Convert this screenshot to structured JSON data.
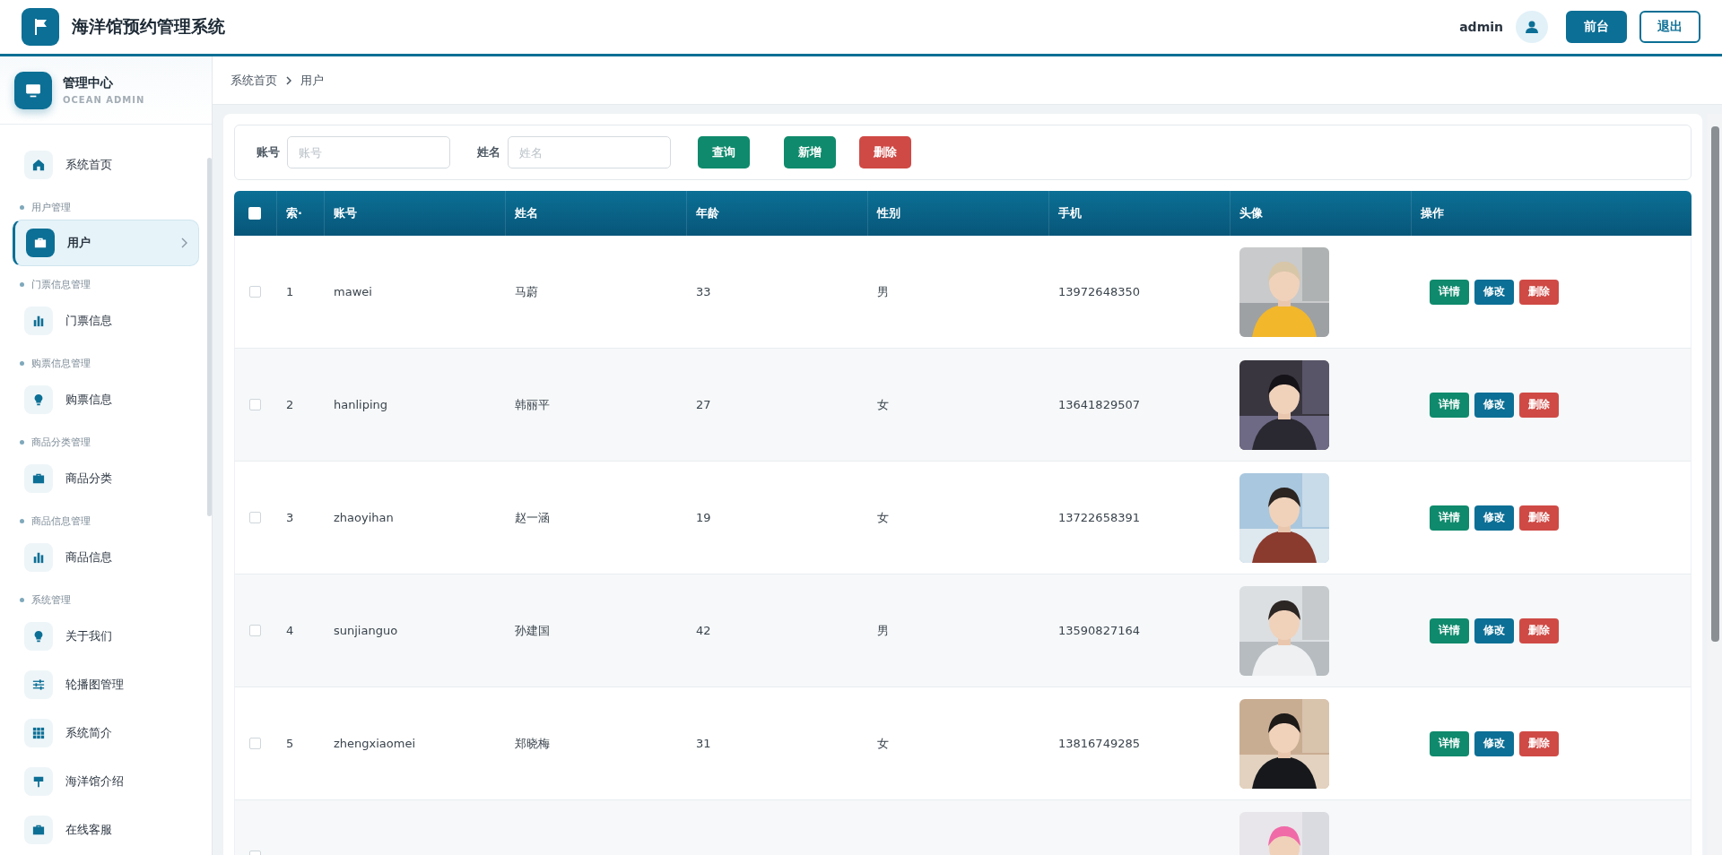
{
  "header": {
    "title": "海洋馆预约管理系统",
    "user": "admin",
    "buttons": [
      {
        "label": "前台",
        "kind": "solid"
      },
      {
        "label": "退出",
        "kind": "outline"
      }
    ]
  },
  "sidebar": {
    "title": "管理中心",
    "subtitle": "OCEAN ADMIN",
    "groups": [
      {
        "items": [
          {
            "label": "系统首页",
            "selected": false
          }
        ]
      },
      {
        "label": "用户管理",
        "items": [
          {
            "label": "用户",
            "selected": true
          }
        ]
      },
      {
        "label": "门票信息管理",
        "items": [
          {
            "label": "门票信息",
            "selected": false
          }
        ]
      },
      {
        "label": "购票信息管理",
        "items": [
          {
            "label": "购票信息",
            "selected": false
          }
        ]
      },
      {
        "label": "商品分类管理",
        "items": [
          {
            "label": "商品分类",
            "selected": false
          }
        ]
      },
      {
        "label": "商品信息管理",
        "items": [
          {
            "label": "商品信息",
            "selected": false
          }
        ]
      },
      {
        "label": "系统管理",
        "items": [
          {
            "label": "关于我们",
            "selected": false
          },
          {
            "label": "轮播图管理",
            "selected": false
          },
          {
            "label": "系统简介",
            "selected": false
          },
          {
            "label": "海洋馆介绍",
            "selected": false
          },
          {
            "label": "在线客服",
            "selected": false
          }
        ]
      }
    ]
  },
  "breadcrumb": [
    "系统首页",
    "用户"
  ],
  "search": {
    "fields": [
      {
        "label": "账号",
        "placeholder": "账号"
      },
      {
        "label": "姓名",
        "placeholder": "姓名"
      }
    ],
    "buttons": [
      {
        "label": "查询",
        "kind": "green"
      },
      {
        "label": "新增",
        "kind": "green"
      },
      {
        "label": "删除",
        "kind": "red"
      }
    ]
  },
  "table": {
    "header_checked": false,
    "columns": [
      "索·",
      "账号",
      "姓名",
      "年龄",
      "性别",
      "手机",
      "头像",
      "操作"
    ],
    "rows": [
      {
        "checked": false,
        "cells": [
          "1",
          "mawei",
          "马蔚",
          "33",
          "男",
          "13972648350"
        ],
        "avatar": {
          "kind": "picture"
        },
        "actions": [
          {
            "label": "详情",
            "kind": "green"
          },
          {
            "label": "修改",
            "kind": "blue"
          },
          {
            "label": "删除",
            "kind": "red"
          }
        ]
      },
      {
        "checked": false,
        "cells": [
          "2",
          "hanliping",
          "韩丽平",
          "27",
          "女",
          "13641829507"
        ],
        "avatar": {
          "kind": "picture"
        },
        "actions": [
          {
            "label": "详情",
            "kind": "green"
          },
          {
            "label": "修改",
            "kind": "blue"
          },
          {
            "label": "删除",
            "kind": "red"
          }
        ]
      },
      {
        "checked": false,
        "cells": [
          "3",
          "zhaoyihan",
          "赵一涵",
          "19",
          "女",
          "13722658391"
        ],
        "avatar": {
          "kind": "picture"
        },
        "actions": [
          {
            "label": "详情",
            "kind": "green"
          },
          {
            "label": "修改",
            "kind": "blue"
          },
          {
            "label": "删除",
            "kind": "red"
          }
        ]
      },
      {
        "checked": false,
        "cells": [
          "4",
          "sunjianguo",
          "孙建国",
          "42",
          "男",
          "13590827164"
        ],
        "avatar": {
          "kind": "picture"
        },
        "actions": [
          {
            "label": "详情",
            "kind": "green"
          },
          {
            "label": "修改",
            "kind": "blue"
          },
          {
            "label": "删除",
            "kind": "red"
          }
        ]
      },
      {
        "checked": false,
        "cells": [
          "5",
          "zhengxiaomei",
          "郑晓梅",
          "31",
          "女",
          "13816749285"
        ],
        "avatar": {
          "kind": "picture"
        },
        "actions": [
          {
            "label": "详情",
            "kind": "green"
          },
          {
            "label": "修改",
            "kind": "blue"
          },
          {
            "label": "删除",
            "kind": "red"
          }
        ]
      },
      {
        "checked": false,
        "cells": [],
        "avatar": {
          "kind": "picture"
        },
        "actions": []
      }
    ]
  }
}
